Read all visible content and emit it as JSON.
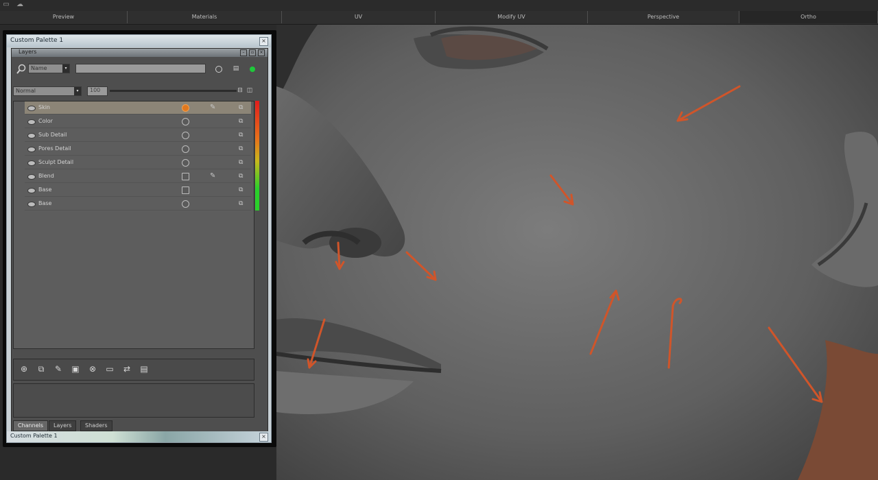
{
  "top_icons": [
    "window-icon",
    "cloud-icon"
  ],
  "tabs": [
    {
      "label": "Preview",
      "selected": false
    },
    {
      "label": "Materials",
      "selected": false
    },
    {
      "label": "UV",
      "selected": false
    },
    {
      "label": "Modify UV",
      "selected": false
    },
    {
      "label": "Perspective",
      "selected": false
    },
    {
      "label": "Ortho",
      "selected": true
    }
  ],
  "palette": {
    "title": "Custom Palette 1",
    "footer_title": "Custom Palette 1",
    "close": "×",
    "panel_title": "Layers",
    "filter": {
      "value": "Name",
      "arrow": "▾"
    },
    "search": {
      "value": ""
    },
    "blend": {
      "value": "Normal",
      "arrow": "▾"
    },
    "opacity_field": "100",
    "layers": [
      {
        "name": "Skin",
        "selected": true,
        "material": "orange",
        "brush": true
      },
      {
        "name": "Color",
        "selected": false,
        "material": "circle",
        "brush": false
      },
      {
        "name": "Sub Detail",
        "selected": false,
        "material": "circle",
        "brush": false
      },
      {
        "name": "Pores Detail",
        "selected": false,
        "material": "circle",
        "brush": false
      },
      {
        "name": "Sculpt Detail",
        "selected": false,
        "material": "circle",
        "brush": false
      },
      {
        "name": "Blend",
        "selected": false,
        "material": "square",
        "brush": true
      },
      {
        "name": "Base",
        "selected": false,
        "material": "square",
        "brush": false
      },
      {
        "name": "Base",
        "selected": false,
        "material": "circle",
        "brush": false
      }
    ],
    "toolbar_icons": [
      "new-layer-icon",
      "duplicate-layer-icon",
      "paint-layer-icon",
      "mask-layer-icon",
      "merge-layer-icon",
      "flatten-icon",
      "adjust-icon",
      "delete-layer-icon"
    ],
    "bottom_tabs": [
      {
        "label": "Channels",
        "selected": true
      },
      {
        "label": "Layers",
        "selected": false
      },
      {
        "label": "Shaders",
        "selected": false
      }
    ]
  },
  "colors": {
    "accent_orange": "#e0781e",
    "meter_top": "#e21c1c",
    "meter_bottom": "#2ad02a",
    "status_green": "#1ec93a",
    "annotation_arrow": "#d0552a"
  }
}
